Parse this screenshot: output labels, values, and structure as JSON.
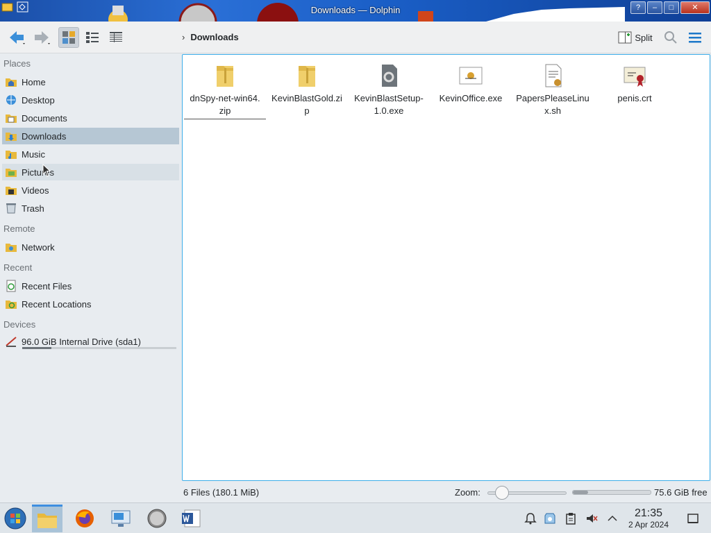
{
  "window": {
    "title": "Downloads — Dolphin"
  },
  "toolbar": {
    "breadcrumb": "Downloads",
    "split_label": "Split"
  },
  "sidebar": {
    "sections": {
      "places": "Places",
      "remote": "Remote",
      "recent": "Recent",
      "devices": "Devices"
    },
    "places": [
      {
        "label": "Home",
        "icon": "home-folder-icon"
      },
      {
        "label": "Desktop",
        "icon": "desktop-icon"
      },
      {
        "label": "Documents",
        "icon": "documents-folder-icon"
      },
      {
        "label": "Downloads",
        "icon": "downloads-folder-icon"
      },
      {
        "label": "Music",
        "icon": "music-folder-icon"
      },
      {
        "label": "Pictures",
        "icon": "pictures-folder-icon"
      },
      {
        "label": "Videos",
        "icon": "videos-folder-icon"
      },
      {
        "label": "Trash",
        "icon": "trash-icon"
      }
    ],
    "remote": [
      {
        "label": "Network",
        "icon": "network-folder-icon"
      }
    ],
    "recent": [
      {
        "label": "Recent Files",
        "icon": "recent-files-icon"
      },
      {
        "label": "Recent Locations",
        "icon": "recent-locations-icon"
      }
    ],
    "devices": [
      {
        "label": "96.0 GiB Internal Drive (sda1)",
        "icon": "drive-icon",
        "usage_fraction": 0.19
      }
    ]
  },
  "files": [
    {
      "name": "dnSpy-net-win64.zip",
      "icon": "zip-icon"
    },
    {
      "name": "KevinBlastGold.zip",
      "icon": "zip-icon"
    },
    {
      "name": "KevinBlastSetup-1.0.exe",
      "icon": "executable-icon"
    },
    {
      "name": "KevinOffice.exe",
      "icon": "app-icon"
    },
    {
      "name": "PapersPleaseLinux.sh",
      "icon": "script-icon"
    },
    {
      "name": "penis.crt",
      "icon": "certificate-icon"
    }
  ],
  "status": {
    "summary": "6 Files (180.1 MiB)",
    "zoom_label": "Zoom:",
    "zoom_fraction": 0.12,
    "free_space": "75.6 GiB free",
    "space_used_fraction": 0.2
  },
  "taskbar": {
    "time": "21:35",
    "date": "2 Apr 2024"
  },
  "colors": {
    "accent": "#3daee9",
    "selection": "#b6c7d4",
    "titlebar": "#1a5ec6"
  }
}
